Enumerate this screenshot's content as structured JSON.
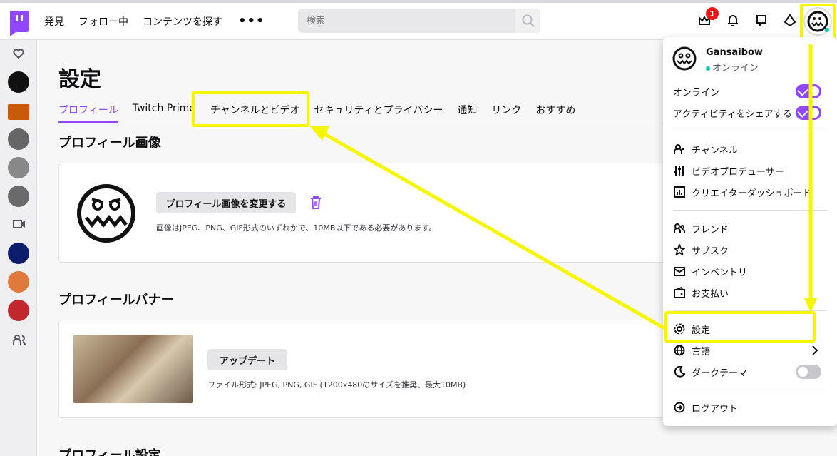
{
  "nav": {
    "links": [
      "発見",
      "フォロー中",
      "コンテンツを探す"
    ],
    "more": "•••",
    "search_placeholder": "検索",
    "notification_count": "1"
  },
  "page": {
    "title": "設定",
    "tabs": [
      "プロフィール",
      "Twitch Prime",
      "チャンネルとビデオ",
      "セキュリティとプライバシー",
      "通知",
      "リンク",
      "おすすめ"
    ],
    "active_tab": "プロフィール"
  },
  "profile_image": {
    "heading": "プロフィール画像",
    "change_button": "プロフィール画像を変更する",
    "note": "画像はJPEG、PNG、GIF形式のいずれかで、10MB以下である必要があります。"
  },
  "profile_banner": {
    "heading": "プロフィールバナー",
    "update_button": "アップデート",
    "note": "ファイル形式: JPEG, PNG, GIF (1200x480のサイズを推奨、最大10MB)"
  },
  "profile_settings": {
    "heading": "プロフィール設定"
  },
  "menu": {
    "username": "Gansaibow",
    "status": "オンライン",
    "toggles": [
      {
        "label": "オンライン",
        "on": true
      },
      {
        "label": "アクティビティをシェアする",
        "on": true
      }
    ],
    "group1": [
      "チャンネル",
      "ビデオプロデューサー",
      "クリエイターダッシュボード"
    ],
    "group2": [
      "フレンド",
      "サブスク",
      "インベントリ",
      "お支払い"
    ],
    "settings": "設定",
    "language": "言語",
    "dark_theme": "ダークテーマ",
    "logout": "ログアウト"
  },
  "colors": {
    "accent": "#9147ff",
    "highlight": "#f6f600",
    "badge": "#e91916"
  }
}
